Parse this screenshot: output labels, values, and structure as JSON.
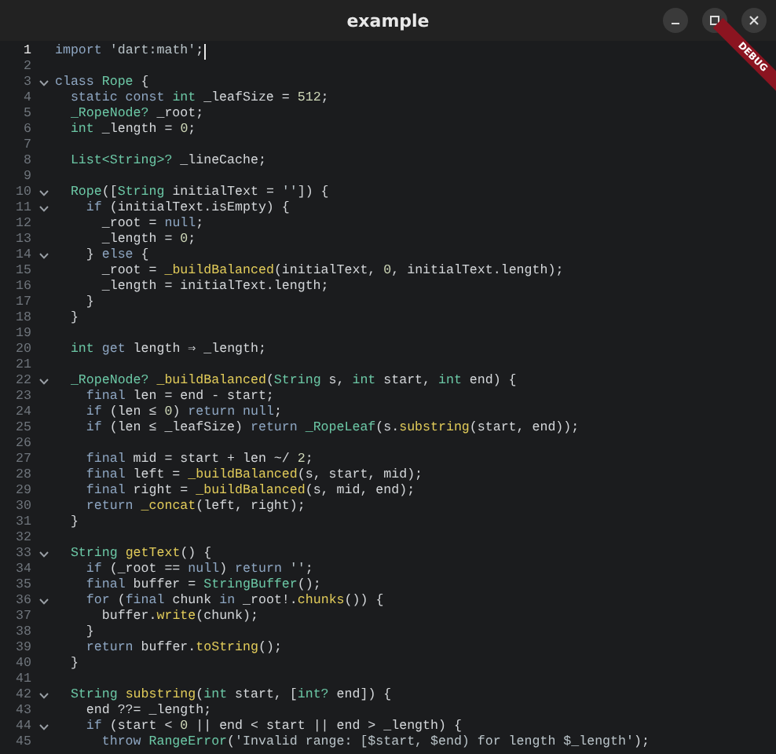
{
  "window": {
    "title": "example",
    "controls": [
      {
        "kind": "minimize"
      },
      {
        "kind": "maximize"
      },
      {
        "kind": "close"
      }
    ]
  },
  "banner": {
    "text": "DEBUG"
  },
  "editor": {
    "lines": [
      {
        "n": "1",
        "fold": false,
        "current": true,
        "tokens": [
          {
            "kind": "keyword",
            "text": "import "
          },
          {
            "kind": "string",
            "text": "'dart:math'"
          },
          {
            "kind": "plain",
            "text": ";"
          }
        ]
      },
      {
        "n": "2",
        "fold": false,
        "current": false
      },
      {
        "n": "3",
        "fold": true,
        "current": false,
        "tokens": [
          {
            "kind": "keyword",
            "text": "class "
          },
          {
            "kind": "type",
            "text": "Rope"
          },
          {
            "kind": "plain",
            "text": " {"
          }
        ]
      },
      {
        "n": "4",
        "fold": false,
        "current": false,
        "tokens": [
          {
            "kind": "keyword",
            "text": "  static const "
          },
          {
            "kind": "type",
            "text": "int"
          },
          {
            "kind": "plain",
            "text": " _leafSize = "
          },
          {
            "kind": "number",
            "text": "512"
          },
          {
            "kind": "plain",
            "text": ";"
          }
        ]
      },
      {
        "n": "5",
        "fold": false,
        "current": false,
        "tokens": [
          {
            "kind": "type",
            "text": "  _RopeNode?"
          },
          {
            "kind": "plain",
            "text": " _root;"
          }
        ]
      },
      {
        "n": "6",
        "fold": false,
        "current": false,
        "tokens": [
          {
            "kind": "type",
            "text": "  int"
          },
          {
            "kind": "plain",
            "text": " _length = "
          },
          {
            "kind": "number",
            "text": "0"
          },
          {
            "kind": "plain",
            "text": ";"
          }
        ]
      },
      {
        "n": "7",
        "fold": false,
        "current": false
      },
      {
        "n": "8",
        "fold": false,
        "current": false,
        "tokens": [
          {
            "kind": "type",
            "text": "  List<String>?"
          },
          {
            "kind": "plain",
            "text": " _lineCache;"
          }
        ]
      },
      {
        "n": "9",
        "fold": false,
        "current": false
      },
      {
        "n": "10",
        "fold": true,
        "current": false,
        "tokens": [
          {
            "kind": "type",
            "text": "  Rope"
          },
          {
            "kind": "plain",
            "text": "(["
          },
          {
            "kind": "type",
            "text": "String"
          },
          {
            "kind": "plain",
            "text": " initialText = "
          },
          {
            "kind": "string",
            "text": "''"
          },
          {
            "kind": "plain",
            "text": "]) {"
          }
        ]
      },
      {
        "n": "11",
        "fold": true,
        "current": false,
        "tokens": [
          {
            "kind": "keyword",
            "text": "    if"
          },
          {
            "kind": "plain",
            "text": " (initialText.isEmpty) {"
          }
        ]
      },
      {
        "n": "12",
        "fold": false,
        "current": false,
        "tokens": [
          {
            "kind": "plain",
            "text": "      _root = "
          },
          {
            "kind": "keyword",
            "text": "null"
          },
          {
            "kind": "plain",
            "text": ";"
          }
        ]
      },
      {
        "n": "13",
        "fold": false,
        "current": false,
        "tokens": [
          {
            "kind": "plain",
            "text": "      _length = "
          },
          {
            "kind": "number",
            "text": "0"
          },
          {
            "kind": "plain",
            "text": ";"
          }
        ]
      },
      {
        "n": "14",
        "fold": true,
        "current": false,
        "tokens": [
          {
            "kind": "plain",
            "text": "    } "
          },
          {
            "kind": "keyword",
            "text": "else"
          },
          {
            "kind": "plain",
            "text": " {"
          }
        ]
      },
      {
        "n": "15",
        "fold": false,
        "current": false,
        "tokens": [
          {
            "kind": "plain",
            "text": "      _root = "
          },
          {
            "kind": "function",
            "text": "_buildBalanced"
          },
          {
            "kind": "plain",
            "text": "(initialText, "
          },
          {
            "kind": "number",
            "text": "0"
          },
          {
            "kind": "plain",
            "text": ", initialText.length);"
          }
        ]
      },
      {
        "n": "16",
        "fold": false,
        "current": false,
        "tokens": [
          {
            "kind": "plain",
            "text": "      _length = initialText.length;"
          }
        ]
      },
      {
        "n": "17",
        "fold": false,
        "current": false,
        "tokens": [
          {
            "kind": "plain",
            "text": "    }"
          }
        ]
      },
      {
        "n": "18",
        "fold": false,
        "current": false,
        "tokens": [
          {
            "kind": "plain",
            "text": "  }"
          }
        ]
      },
      {
        "n": "19",
        "fold": false,
        "current": false
      },
      {
        "n": "20",
        "fold": false,
        "current": false,
        "tokens": [
          {
            "kind": "type",
            "text": "  int"
          },
          {
            "kind": "keyword",
            "text": " get"
          },
          {
            "kind": "plain",
            "text": " length ⇒ _length;"
          }
        ]
      },
      {
        "n": "21",
        "fold": false,
        "current": false
      },
      {
        "n": "22",
        "fold": true,
        "current": false,
        "tokens": [
          {
            "kind": "type",
            "text": "  _RopeNode?"
          },
          {
            "kind": "function",
            "text": " _buildBalanced"
          },
          {
            "kind": "plain",
            "text": "("
          },
          {
            "kind": "type",
            "text": "String"
          },
          {
            "kind": "plain",
            "text": " s, "
          },
          {
            "kind": "type",
            "text": "int"
          },
          {
            "kind": "plain",
            "text": " start, "
          },
          {
            "kind": "type",
            "text": "int"
          },
          {
            "kind": "plain",
            "text": " end) {"
          }
        ]
      },
      {
        "n": "23",
        "fold": false,
        "current": false,
        "tokens": [
          {
            "kind": "keyword",
            "text": "    final"
          },
          {
            "kind": "plain",
            "text": " len = end - start;"
          }
        ]
      },
      {
        "n": "24",
        "fold": false,
        "current": false,
        "tokens": [
          {
            "kind": "keyword",
            "text": "    if"
          },
          {
            "kind": "plain",
            "text": " (len ≤ "
          },
          {
            "kind": "number",
            "text": "0"
          },
          {
            "kind": "plain",
            "text": ") "
          },
          {
            "kind": "keyword",
            "text": "return null"
          },
          {
            "kind": "plain",
            "text": ";"
          }
        ]
      },
      {
        "n": "25",
        "fold": false,
        "current": false,
        "tokens": [
          {
            "kind": "keyword",
            "text": "    if"
          },
          {
            "kind": "plain",
            "text": " (len ≤ _leafSize) "
          },
          {
            "kind": "keyword",
            "text": "return "
          },
          {
            "kind": "type",
            "text": "_RopeLeaf"
          },
          {
            "kind": "plain",
            "text": "(s."
          },
          {
            "kind": "function",
            "text": "substring"
          },
          {
            "kind": "plain",
            "text": "(start, end));"
          }
        ]
      },
      {
        "n": "26",
        "fold": false,
        "current": false
      },
      {
        "n": "27",
        "fold": false,
        "current": false,
        "tokens": [
          {
            "kind": "keyword",
            "text": "    final"
          },
          {
            "kind": "plain",
            "text": " mid = start + len ~/ "
          },
          {
            "kind": "number",
            "text": "2"
          },
          {
            "kind": "plain",
            "text": ";"
          }
        ]
      },
      {
        "n": "28",
        "fold": false,
        "current": false,
        "tokens": [
          {
            "kind": "keyword",
            "text": "    final"
          },
          {
            "kind": "plain",
            "text": " left = "
          },
          {
            "kind": "function",
            "text": "_buildBalanced"
          },
          {
            "kind": "plain",
            "text": "(s, start, mid);"
          }
        ]
      },
      {
        "n": "29",
        "fold": false,
        "current": false,
        "tokens": [
          {
            "kind": "keyword",
            "text": "    final"
          },
          {
            "kind": "plain",
            "text": " right = "
          },
          {
            "kind": "function",
            "text": "_buildBalanced"
          },
          {
            "kind": "plain",
            "text": "(s, mid, end);"
          }
        ]
      },
      {
        "n": "30",
        "fold": false,
        "current": false,
        "tokens": [
          {
            "kind": "keyword",
            "text": "    return "
          },
          {
            "kind": "function",
            "text": "_concat"
          },
          {
            "kind": "plain",
            "text": "(left, right);"
          }
        ]
      },
      {
        "n": "31",
        "fold": false,
        "current": false,
        "tokens": [
          {
            "kind": "plain",
            "text": "  }"
          }
        ]
      },
      {
        "n": "32",
        "fold": false,
        "current": false
      },
      {
        "n": "33",
        "fold": true,
        "current": false,
        "tokens": [
          {
            "kind": "type",
            "text": "  String"
          },
          {
            "kind": "function",
            "text": " getText"
          },
          {
            "kind": "plain",
            "text": "() {"
          }
        ]
      },
      {
        "n": "34",
        "fold": false,
        "current": false,
        "tokens": [
          {
            "kind": "keyword",
            "text": "    if"
          },
          {
            "kind": "plain",
            "text": " (_root == "
          },
          {
            "kind": "keyword",
            "text": "null"
          },
          {
            "kind": "plain",
            "text": ") "
          },
          {
            "kind": "keyword",
            "text": "return "
          },
          {
            "kind": "string",
            "text": "''"
          },
          {
            "kind": "plain",
            "text": ";"
          }
        ]
      },
      {
        "n": "35",
        "fold": false,
        "current": false,
        "tokens": [
          {
            "kind": "keyword",
            "text": "    final"
          },
          {
            "kind": "plain",
            "text": " buffer = "
          },
          {
            "kind": "type",
            "text": "StringBuffer"
          },
          {
            "kind": "plain",
            "text": "();"
          }
        ]
      },
      {
        "n": "36",
        "fold": true,
        "current": false,
        "tokens": [
          {
            "kind": "keyword",
            "text": "    for"
          },
          {
            "kind": "plain",
            "text": " ("
          },
          {
            "kind": "keyword",
            "text": "final"
          },
          {
            "kind": "plain",
            "text": " chunk "
          },
          {
            "kind": "keyword",
            "text": "in"
          },
          {
            "kind": "plain",
            "text": " _root!."
          },
          {
            "kind": "function",
            "text": "chunks"
          },
          {
            "kind": "plain",
            "text": "()) {"
          }
        ]
      },
      {
        "n": "37",
        "fold": false,
        "current": false,
        "tokens": [
          {
            "kind": "plain",
            "text": "      buffer."
          },
          {
            "kind": "function",
            "text": "write"
          },
          {
            "kind": "plain",
            "text": "(chunk);"
          }
        ]
      },
      {
        "n": "38",
        "fold": false,
        "current": false,
        "tokens": [
          {
            "kind": "plain",
            "text": "    }"
          }
        ]
      },
      {
        "n": "39",
        "fold": false,
        "current": false,
        "tokens": [
          {
            "kind": "keyword",
            "text": "    return"
          },
          {
            "kind": "plain",
            "text": " buffer."
          },
          {
            "kind": "function",
            "text": "toString"
          },
          {
            "kind": "plain",
            "text": "();"
          }
        ]
      },
      {
        "n": "40",
        "fold": false,
        "current": false,
        "tokens": [
          {
            "kind": "plain",
            "text": "  }"
          }
        ]
      },
      {
        "n": "41",
        "fold": false,
        "current": false
      },
      {
        "n": "42",
        "fold": true,
        "current": false,
        "tokens": [
          {
            "kind": "type",
            "text": "  String"
          },
          {
            "kind": "function",
            "text": " substring"
          },
          {
            "kind": "plain",
            "text": "("
          },
          {
            "kind": "type",
            "text": "int"
          },
          {
            "kind": "plain",
            "text": " start, ["
          },
          {
            "kind": "type",
            "text": "int?"
          },
          {
            "kind": "plain",
            "text": " end]) {"
          }
        ]
      },
      {
        "n": "43",
        "fold": false,
        "current": false,
        "tokens": [
          {
            "kind": "plain",
            "text": "    end ??= _length;"
          }
        ]
      },
      {
        "n": "44",
        "fold": true,
        "current": false,
        "tokens": [
          {
            "kind": "keyword",
            "text": "    if"
          },
          {
            "kind": "plain",
            "text": " (start < "
          },
          {
            "kind": "number",
            "text": "0"
          },
          {
            "kind": "plain",
            "text": " || end < start || end > _length) {"
          }
        ]
      },
      {
        "n": "45",
        "fold": false,
        "current": false,
        "tokens": [
          {
            "kind": "keyword",
            "text": "      throw "
          },
          {
            "kind": "type",
            "text": "RangeError"
          },
          {
            "kind": "plain",
            "text": "("
          },
          {
            "kind": "string",
            "text": "'Invalid range: [$start, $end) for length $_length'"
          },
          {
            "kind": "plain",
            "text": ");"
          }
        ]
      }
    ]
  }
}
